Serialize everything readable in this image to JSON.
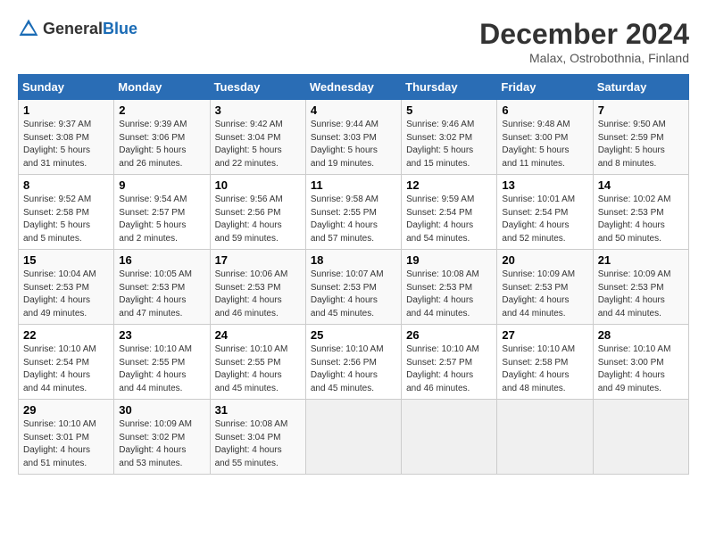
{
  "logo": {
    "general": "General",
    "blue": "Blue"
  },
  "title": "December 2024",
  "location": "Malax, Ostrobothnia, Finland",
  "days_of_week": [
    "Sunday",
    "Monday",
    "Tuesday",
    "Wednesday",
    "Thursday",
    "Friday",
    "Saturday"
  ],
  "weeks": [
    [
      {
        "day": "1",
        "sunrise": "9:37 AM",
        "sunset": "3:08 PM",
        "daylight": "5 hours and 31 minutes."
      },
      {
        "day": "2",
        "sunrise": "9:39 AM",
        "sunset": "3:06 PM",
        "daylight": "5 hours and 26 minutes."
      },
      {
        "day": "3",
        "sunrise": "9:42 AM",
        "sunset": "3:04 PM",
        "daylight": "5 hours and 22 minutes."
      },
      {
        "day": "4",
        "sunrise": "9:44 AM",
        "sunset": "3:03 PM",
        "daylight": "5 hours and 19 minutes."
      },
      {
        "day": "5",
        "sunrise": "9:46 AM",
        "sunset": "3:02 PM",
        "daylight": "5 hours and 15 minutes."
      },
      {
        "day": "6",
        "sunrise": "9:48 AM",
        "sunset": "3:00 PM",
        "daylight": "5 hours and 11 minutes."
      },
      {
        "day": "7",
        "sunrise": "9:50 AM",
        "sunset": "2:59 PM",
        "daylight": "5 hours and 8 minutes."
      }
    ],
    [
      {
        "day": "8",
        "sunrise": "9:52 AM",
        "sunset": "2:58 PM",
        "daylight": "5 hours and 5 minutes."
      },
      {
        "day": "9",
        "sunrise": "9:54 AM",
        "sunset": "2:57 PM",
        "daylight": "5 hours and 2 minutes."
      },
      {
        "day": "10",
        "sunrise": "9:56 AM",
        "sunset": "2:56 PM",
        "daylight": "4 hours and 59 minutes."
      },
      {
        "day": "11",
        "sunrise": "9:58 AM",
        "sunset": "2:55 PM",
        "daylight": "4 hours and 57 minutes."
      },
      {
        "day": "12",
        "sunrise": "9:59 AM",
        "sunset": "2:54 PM",
        "daylight": "4 hours and 54 minutes."
      },
      {
        "day": "13",
        "sunrise": "10:01 AM",
        "sunset": "2:54 PM",
        "daylight": "4 hours and 52 minutes."
      },
      {
        "day": "14",
        "sunrise": "10:02 AM",
        "sunset": "2:53 PM",
        "daylight": "4 hours and 50 minutes."
      }
    ],
    [
      {
        "day": "15",
        "sunrise": "10:04 AM",
        "sunset": "2:53 PM",
        "daylight": "4 hours and 49 minutes."
      },
      {
        "day": "16",
        "sunrise": "10:05 AM",
        "sunset": "2:53 PM",
        "daylight": "4 hours and 47 minutes."
      },
      {
        "day": "17",
        "sunrise": "10:06 AM",
        "sunset": "2:53 PM",
        "daylight": "4 hours and 46 minutes."
      },
      {
        "day": "18",
        "sunrise": "10:07 AM",
        "sunset": "2:53 PM",
        "daylight": "4 hours and 45 minutes."
      },
      {
        "day": "19",
        "sunrise": "10:08 AM",
        "sunset": "2:53 PM",
        "daylight": "4 hours and 44 minutes."
      },
      {
        "day": "20",
        "sunrise": "10:09 AM",
        "sunset": "2:53 PM",
        "daylight": "4 hours and 44 minutes."
      },
      {
        "day": "21",
        "sunrise": "10:09 AM",
        "sunset": "2:53 PM",
        "daylight": "4 hours and 44 minutes."
      }
    ],
    [
      {
        "day": "22",
        "sunrise": "10:10 AM",
        "sunset": "2:54 PM",
        "daylight": "4 hours and 44 minutes."
      },
      {
        "day": "23",
        "sunrise": "10:10 AM",
        "sunset": "2:55 PM",
        "daylight": "4 hours and 44 minutes."
      },
      {
        "day": "24",
        "sunrise": "10:10 AM",
        "sunset": "2:55 PM",
        "daylight": "4 hours and 45 minutes."
      },
      {
        "day": "25",
        "sunrise": "10:10 AM",
        "sunset": "2:56 PM",
        "daylight": "4 hours and 45 minutes."
      },
      {
        "day": "26",
        "sunrise": "10:10 AM",
        "sunset": "2:57 PM",
        "daylight": "4 hours and 46 minutes."
      },
      {
        "day": "27",
        "sunrise": "10:10 AM",
        "sunset": "2:58 PM",
        "daylight": "4 hours and 48 minutes."
      },
      {
        "day": "28",
        "sunrise": "10:10 AM",
        "sunset": "3:00 PM",
        "daylight": "4 hours and 49 minutes."
      }
    ],
    [
      {
        "day": "29",
        "sunrise": "10:10 AM",
        "sunset": "3:01 PM",
        "daylight": "4 hours and 51 minutes."
      },
      {
        "day": "30",
        "sunrise": "10:09 AM",
        "sunset": "3:02 PM",
        "daylight": "4 hours and 53 minutes."
      },
      {
        "day": "31",
        "sunrise": "10:08 AM",
        "sunset": "3:04 PM",
        "daylight": "4 hours and 55 minutes."
      },
      null,
      null,
      null,
      null
    ]
  ],
  "labels": {
    "sunrise": "Sunrise:",
    "sunset": "Sunset:",
    "daylight": "Daylight:"
  }
}
